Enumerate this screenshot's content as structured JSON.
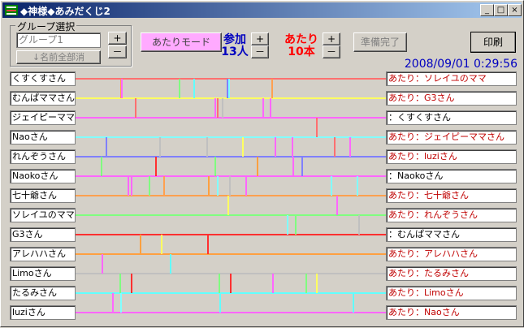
{
  "window": {
    "title": "◆神様◆あみだくじ2",
    "minimize": "_",
    "maximize": "□",
    "close": "×"
  },
  "group": {
    "legend": "グループ選択",
    "current_placeholder": "グループ1",
    "plus": "+",
    "minus": "－",
    "erase_all_names": "↓名前全部消"
  },
  "atari_mode": "あたりモード",
  "participants": {
    "label": "参加",
    "count": "13人",
    "plus": "+",
    "minus": "－"
  },
  "hits": {
    "label": "あたり",
    "count": "10本",
    "plus": "+",
    "minus": "－"
  },
  "ready_button": "準備完了",
  "print_button": "印刷",
  "timestamp": "2008/09/01  0:29:56",
  "names": [
    "くすくすさん",
    "むんぱママさん",
    "ジェイピーママ",
    "Naoさん",
    "れんぞうさん",
    "Naokoさん",
    "七十爺さん",
    "ソレイユのママ",
    "G3さん",
    "アレハハさん",
    "Limoさん",
    "たるみさん",
    "luziさん"
  ],
  "results": [
    {
      "text": "あたり：ソレイユのママ",
      "hit": true
    },
    {
      "text": "あたり：G3さん",
      "hit": true
    },
    {
      "text": "：くすくすさん",
      "hit": false
    },
    {
      "text": "あたり：ジェイピーママさん",
      "hit": true
    },
    {
      "text": "あたり：luziさん",
      "hit": true
    },
    {
      "text": "：Naokoさん",
      "hit": false
    },
    {
      "text": "あたり：七十爺さん",
      "hit": true
    },
    {
      "text": "あたり：れんぞうさん",
      "hit": true
    },
    {
      "text": "：むんぱママさん",
      "hit": false
    },
    {
      "text": "あたり：アレハハさん",
      "hit": true
    },
    {
      "text": "あたり：たるみさん",
      "hit": true
    },
    {
      "text": "あたり：Limoさん",
      "hit": true
    },
    {
      "text": "あたり：Naoさん",
      "hit": true
    }
  ],
  "colors": {
    "title_bar": "#0a246a",
    "hit_text": "#c00000",
    "label_red": "#ff0000",
    "label_blue": "#0000c0",
    "atari_mode_bg": "#ffaaff",
    "line_colors": [
      "#ff7070",
      "#ffff60",
      "#ff66ff",
      "#80ffff",
      "#8080ff",
      "#ff66ff",
      "#ffa050",
      "#80ff80",
      "#ff3030",
      "#ffa040",
      "#c0c0c0",
      "#60ffff",
      "#ff66ff"
    ]
  }
}
